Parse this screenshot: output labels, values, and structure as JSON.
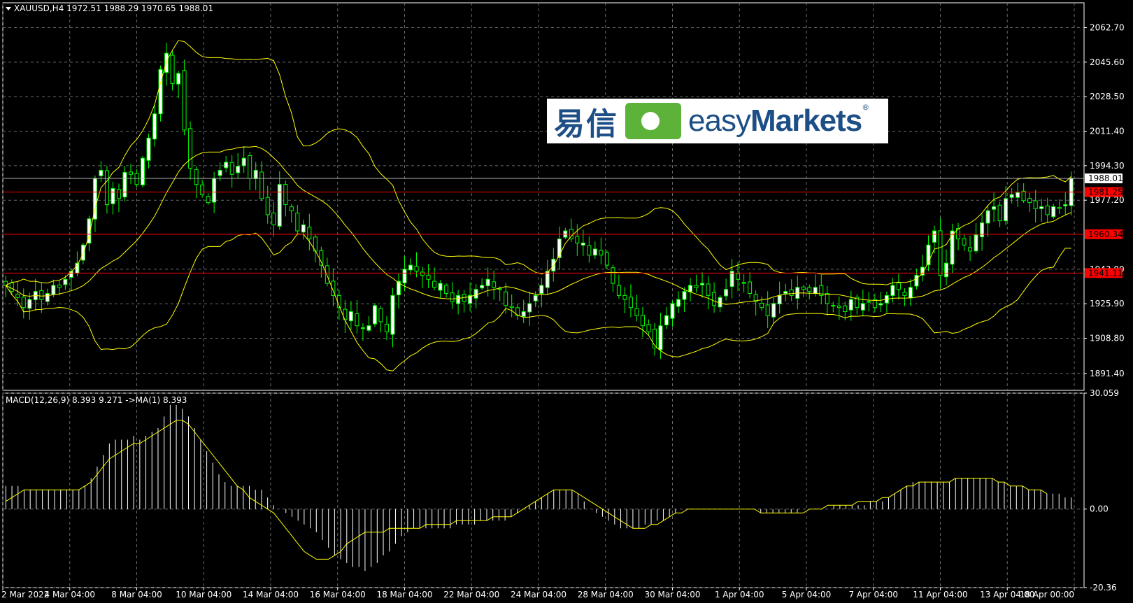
{
  "header": {
    "symbol_line": "XAUUSD,H4  1972.51 1988.29 1970.65 1988.01"
  },
  "macd_header": "MACD(12,26,9) 8.393 9.271  ->MA(1) 8.393",
  "logo": {
    "chinese": "易信",
    "english_prefix": "easy",
    "english_suffix": "Markets",
    "reg": "®"
  },
  "colors": {
    "background": "#000000",
    "grid": "#6b6b6b",
    "candle_bull": "#00ff00",
    "candle_bear": "#ffffff",
    "bands": "#ffff00",
    "level_line": "#ff0000",
    "current_price_line": "#b0b0b0",
    "macd_hist": "#ffffff",
    "macd_signal": "#ffff00",
    "text": "#ffffff"
  },
  "chart_data": [
    {
      "type": "candlestick",
      "name": "XAUUSD,H4",
      "ylim": [
        1883,
        2075
      ],
      "y_ticks": [
        "2062.70",
        "2045.60",
        "2028.50",
        "2011.40",
        "1994.30",
        "1977.20",
        "1943.00",
        "1925.90",
        "1908.80",
        "1891.40"
      ],
      "x_tick_labels": [
        "2 Mar 2022",
        "4 Mar 04:00",
        "8 Mar 04:00",
        "10 Mar 04:00",
        "14 Mar 04:00",
        "16 Mar 04:00",
        "18 Mar 04:00",
        "22 Mar 04:00",
        "24 Mar 04:00",
        "28 Mar 04:00",
        "30 Mar 04:00",
        "1 Apr 04:00",
        "5 Apr 04:00",
        "7 Apr 04:00",
        "11 Apr 04:00",
        "13 Apr 04:00",
        "18 Apr 00:00"
      ],
      "price_levels": [
        {
          "value": 1981.25,
          "label": "1981.25",
          "color": "#ff0000"
        },
        {
          "value": 1960.34,
          "label": "1960.34",
          "color": "#ff0000"
        },
        {
          "value": 1941.11,
          "label": "1941.11",
          "color": "#ff0000"
        }
      ],
      "current_price": {
        "value": 1988.01,
        "label": "1988.01"
      },
      "close_series": [
        1935,
        1932,
        1929,
        1924,
        1928,
        1932,
        1928,
        1931,
        1935,
        1934,
        1938,
        1942,
        1946,
        1955,
        1968,
        1988,
        1992,
        1975,
        1983,
        1978,
        1991,
        1990,
        1985,
        1998,
        2008,
        2020,
        2042,
        2050,
        2035,
        2040,
        2012,
        1993,
        1985,
        1980,
        1976,
        1988,
        1992,
        1996,
        1990,
        1994,
        1998,
        1988,
        1992,
        1978,
        1970,
        1965,
        1985,
        1975,
        1972,
        1962,
        1965,
        1958,
        1952,
        1945,
        1936,
        1930,
        1924,
        1918,
        1922,
        1915,
        1914,
        1915,
        1925,
        1917,
        1912,
        1930,
        1937,
        1943,
        1945,
        1942,
        1940,
        1938,
        1934,
        1936,
        1931,
        1927,
        1930,
        1927,
        1930,
        1933,
        1935,
        1938,
        1934,
        1933,
        1925,
        1924,
        1920,
        1922,
        1926,
        1930,
        1935,
        1942,
        1948,
        1958,
        1962,
        1958,
        1956,
        1956,
        1950,
        1953,
        1950,
        1945,
        1936,
        1930,
        1928,
        1924,
        1920,
        1915,
        1912,
        1904,
        1915,
        1920,
        1926,
        1928,
        1932,
        1935,
        1934,
        1936,
        1930,
        1925,
        1929,
        1933,
        1942,
        1938,
        1936,
        1931,
        1927,
        1924,
        1920,
        1926,
        1930,
        1932,
        1930,
        1934,
        1933,
        1932,
        1934,
        1930,
        1926,
        1925,
        1924,
        1922,
        1928,
        1924,
        1926,
        1927,
        1924,
        1926,
        1930,
        1935,
        1933,
        1930,
        1934,
        1940,
        1944,
        1955,
        1962,
        1940,
        1946,
        1962,
        1958,
        1955,
        1952,
        1960,
        1966,
        1972,
        1974,
        1967,
        1978,
        1980,
        1981,
        1977,
        1976,
        1973,
        1974,
        1970,
        1974,
        1973,
        1975,
        1988
      ]
    },
    {
      "type": "macd",
      "name": "MACD(12,26,9)",
      "ylim": [
        -20.36,
        30.059
      ],
      "y_ticks": [
        "30.059",
        "0.00",
        "-20.36"
      ],
      "histogram": [
        6,
        6,
        6,
        5,
        5,
        5,
        5,
        5,
        5,
        5,
        5,
        5,
        5,
        6,
        8,
        11,
        14,
        17,
        18,
        18,
        18,
        19,
        18,
        19,
        20,
        21,
        24,
        27,
        27,
        26,
        24,
        21,
        18,
        15,
        12,
        9,
        7,
        6,
        6,
        6,
        6,
        5,
        5,
        3,
        1,
        0,
        -1,
        -2,
        -3,
        -4,
        -5,
        -6,
        -8,
        -10,
        -12,
        -13,
        -14,
        -15,
        -15,
        -16,
        -15,
        -14,
        -12,
        -11,
        -9,
        -7,
        -6,
        -5,
        -5,
        -5,
        -5,
        -5,
        -5,
        -5,
        -4,
        -4,
        -4,
        -4,
        -3,
        -3,
        -3,
        -3,
        -3,
        -2,
        -1,
        0,
        1,
        2,
        3,
        4,
        5,
        5,
        5,
        5,
        4,
        2,
        0,
        -1,
        -2,
        -3,
        -4,
        -5,
        -5,
        -5,
        -5,
        -4,
        -4,
        -3,
        -3,
        -2,
        -1,
        0,
        0,
        0,
        0,
        0,
        0,
        0,
        0,
        0,
        0,
        0,
        0,
        0,
        -1,
        -1,
        -1,
        -1,
        -1,
        -1,
        -1,
        0,
        0,
        0,
        0,
        0,
        1,
        1,
        1,
        1,
        1,
        1,
        2,
        2,
        2,
        3,
        4,
        5,
        6,
        7,
        7,
        7,
        7,
        7,
        7,
        7,
        8,
        8,
        8,
        8,
        8,
        8,
        8,
        7,
        7,
        6,
        6,
        6,
        5,
        5,
        5,
        4,
        4,
        4,
        3,
        3
      ],
      "signal": [
        2,
        3,
        4,
        5,
        5,
        5,
        5,
        5,
        5,
        5,
        5,
        5,
        5,
        6,
        7,
        9,
        11,
        13,
        14,
        15,
        16,
        17,
        17,
        18,
        19,
        20,
        21,
        22,
        23,
        23,
        22,
        20,
        18,
        16,
        14,
        12,
        10,
        8,
        6,
        5,
        3,
        2,
        1,
        0,
        -1,
        -3,
        -5,
        -7,
        -9,
        -11,
        -12,
        -13,
        -13,
        -13,
        -12,
        -11,
        -9,
        -8,
        -7,
        -6,
        -6,
        -6,
        -6,
        -5,
        -5,
        -5,
        -5,
        -5,
        -5,
        -4,
        -4,
        -4,
        -4,
        -4,
        -3,
        -3,
        -3,
        -3,
        -3,
        -3,
        -2,
        -2,
        -2,
        -2,
        -1,
        0,
        1,
        2,
        3,
        4,
        5,
        5,
        5,
        5,
        4,
        3,
        2,
        1,
        0,
        -1,
        -2,
        -3,
        -4,
        -5,
        -5,
        -5,
        -4,
        -4,
        -3,
        -2,
        -1,
        -1,
        0,
        0,
        0,
        0,
        0,
        0,
        0,
        0,
        0,
        0,
        0,
        0,
        -1,
        -1,
        -1,
        -1,
        -1,
        -1,
        -1,
        -1,
        0,
        0,
        0,
        1,
        1,
        1,
        1,
        1,
        2,
        2,
        2,
        2,
        3,
        3,
        4,
        5,
        6,
        6,
        7,
        7,
        7,
        7,
        7,
        7,
        8,
        8,
        8,
        8,
        8,
        8,
        8,
        7,
        7,
        6,
        6,
        6,
        5,
        5,
        5,
        4
      ]
    }
  ]
}
